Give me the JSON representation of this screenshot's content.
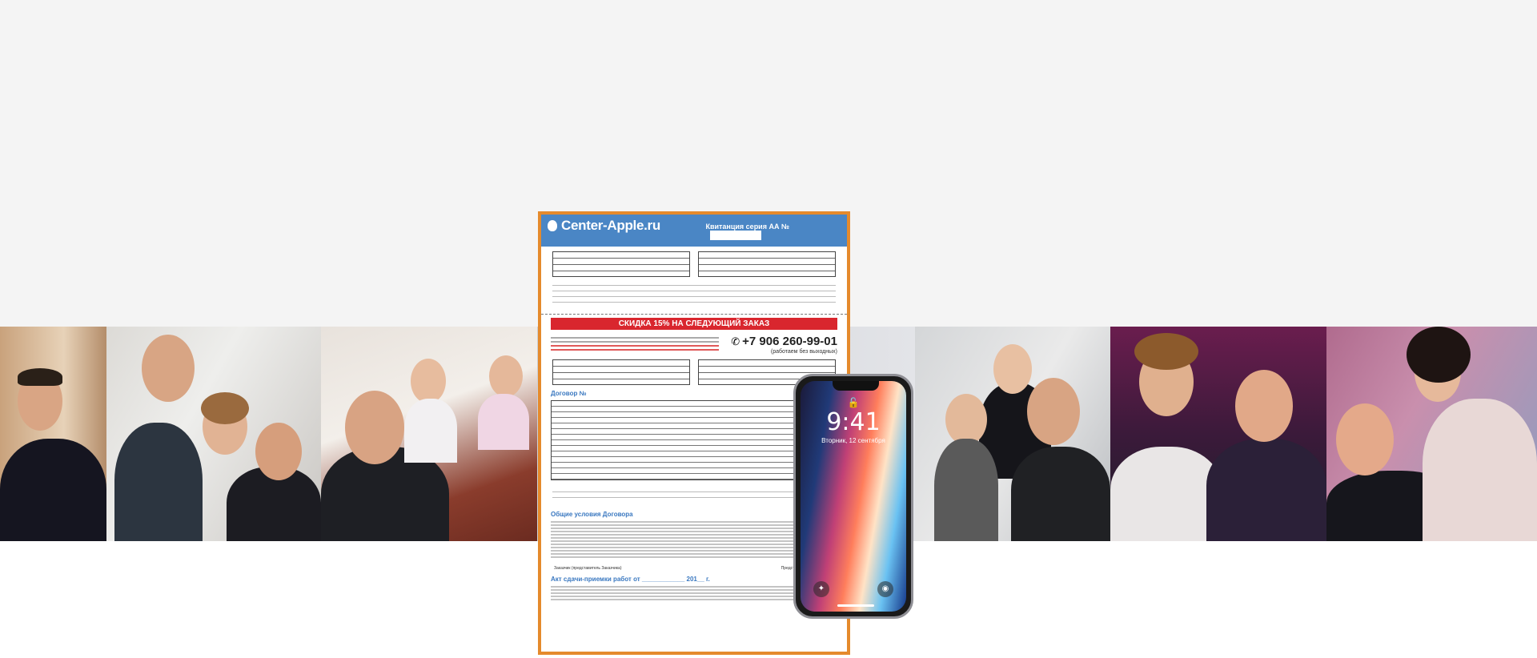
{
  "receipt": {
    "brand": "Center-Apple.ru",
    "receipt_title": "Квитанция серия АА №",
    "discount_banner": "СКИДКА 15% НА СЛЕДУЮЩИЙ ЗАКАЗ",
    "phone": "+7 906 260-99-01",
    "phone_note": "(работаем без выходных)",
    "contract_label": "Договор №",
    "terms_title": "Общие условия Договора",
    "act_title": "Акт сдачи-приемки работ от ____________ 201__ г.",
    "customer_label": "Заказчик (представитель Заказчика)",
    "executor_label": "Представитель исполнителя"
  },
  "phone_screen": {
    "time": "9:41",
    "date": "Вторник, 12 сентября"
  },
  "colors": {
    "header_blue": "#4a86c5",
    "discount_red": "#d9262e",
    "frame_orange": "#e58a2c"
  }
}
